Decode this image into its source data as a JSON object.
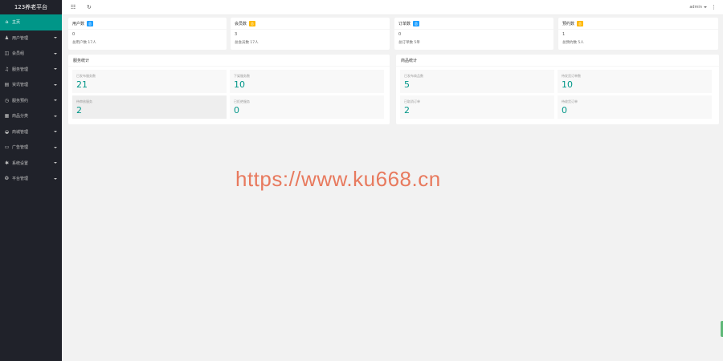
{
  "app": {
    "title": "123养老平台"
  },
  "sidebar": {
    "items": [
      {
        "label": "主页",
        "icon": "home-icon",
        "glyph": "⌂",
        "has_caret": false
      },
      {
        "label": "用户管理",
        "icon": "user-icon",
        "glyph": "♟",
        "has_caret": true
      },
      {
        "label": "会员组",
        "icon": "tag-icon",
        "glyph": "◫",
        "has_caret": true
      },
      {
        "label": "服务管理",
        "icon": "bell-icon",
        "glyph": "♫",
        "has_caret": true
      },
      {
        "label": "资讯管理",
        "icon": "article-icon",
        "glyph": "▤",
        "has_caret": true
      },
      {
        "label": "服务预约",
        "icon": "clock-icon",
        "glyph": "◷",
        "has_caret": true
      },
      {
        "label": "商品分类",
        "icon": "grid-icon",
        "glyph": "▦",
        "has_caret": true
      },
      {
        "label": "商城管理",
        "icon": "cart-icon",
        "glyph": "◒",
        "has_caret": true
      },
      {
        "label": "广告管理",
        "icon": "picture-icon",
        "glyph": "▭",
        "has_caret": true
      },
      {
        "label": "系统设置",
        "icon": "gear-icon",
        "glyph": "✱",
        "has_caret": true
      },
      {
        "label": "平台管理",
        "icon": "cog-icon",
        "glyph": "❂",
        "has_caret": true
      }
    ]
  },
  "header": {
    "menu_icon": "☷",
    "refresh_icon": "↻",
    "user_label": "admin",
    "more_icon": "⋮"
  },
  "cards": [
    {
      "title": "用户数",
      "badge": "总",
      "badge_color": "#1e9fff",
      "value": "0",
      "sub": "总用户数 17人"
    },
    {
      "title": "会员数",
      "badge": "总",
      "badge_color": "#ffb800",
      "value": "3",
      "sub": "总会员数 17人"
    },
    {
      "title": "订单数",
      "badge": "总",
      "badge_color": "#1e9fff",
      "value": "0",
      "sub": "总订单数 5单"
    },
    {
      "title": "预约数",
      "badge": "总",
      "badge_color": "#ffb800",
      "value": "1",
      "sub": "总预约数 5人"
    }
  ],
  "panels": [
    {
      "title": "服务统计",
      "stats": [
        {
          "label": "已发布服务数",
          "value": "21"
        },
        {
          "label": "下架服务数",
          "value": "10"
        },
        {
          "label": "待审核服务",
          "value": "2"
        },
        {
          "label": "已拒绝服务",
          "value": "0"
        }
      ]
    },
    {
      "title": "商品统计",
      "stats": [
        {
          "label": "已发布商品数",
          "value": "5"
        },
        {
          "label": "待发货订单数",
          "value": "10"
        },
        {
          "label": "已取消订单",
          "value": "2"
        },
        {
          "label": "待收货订单",
          "value": "0"
        }
      ]
    }
  ],
  "watermark": "https://www.ku668.cn"
}
